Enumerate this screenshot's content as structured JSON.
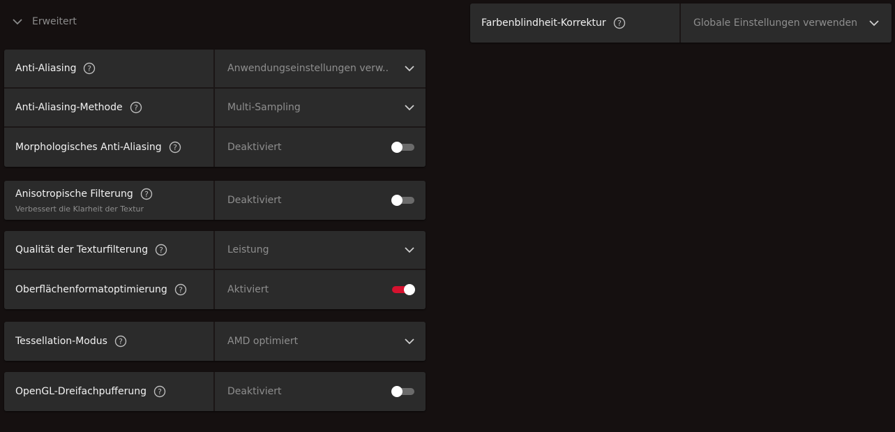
{
  "section": {
    "title": "Erweitert",
    "icon": "chevron-down-icon"
  },
  "colors": {
    "background": "#151010",
    "panel": "#2b2b2b",
    "toggle_on": "#d6122f",
    "toggle_off": "#6b6b6b"
  },
  "settings": [
    {
      "label": "Anti-Aliasing",
      "value": "Anwendungseinstellungen verw...",
      "control": "dropdown"
    },
    {
      "label": "Anti-Aliasing-Methode",
      "value": "Multi-Sampling",
      "control": "dropdown"
    },
    {
      "label": "Morphologisches Anti-Aliasing",
      "value": "Deaktiviert",
      "control": "toggle",
      "on": false
    },
    {
      "label": "Anisotropische Filterung",
      "sublabel": "Verbessert die Klarheit der Textur",
      "value": "Deaktiviert",
      "control": "toggle",
      "on": false
    },
    {
      "label": "Qualität der Texturfilterung",
      "value": "Leistung",
      "control": "dropdown"
    },
    {
      "label": "Oberflächenformatoptimierung",
      "value": "Aktiviert",
      "control": "toggle",
      "on": true
    },
    {
      "label": "Tessellation-Modus",
      "value": "AMD optimiert",
      "control": "dropdown"
    },
    {
      "label": "OpenGL-Dreifachpufferung",
      "value": "Deaktiviert",
      "control": "toggle",
      "on": false
    }
  ],
  "right_panel": {
    "label": "Farbenblindheit-Korrektur",
    "value": "Globale Einstellungen verwenden",
    "control": "dropdown"
  }
}
